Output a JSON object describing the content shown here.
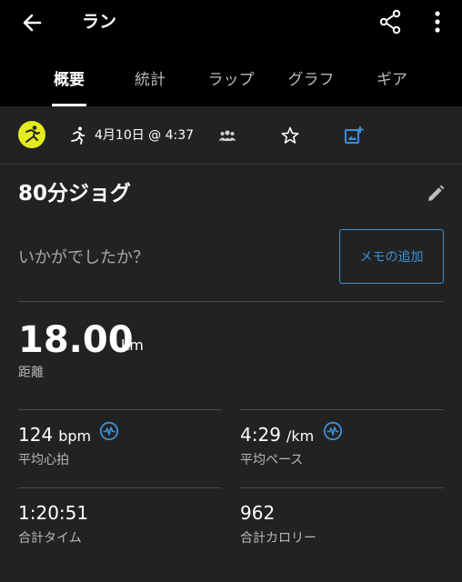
{
  "header": {
    "title": "ラン",
    "icons": [
      "back-arrow-icon",
      "share-icon",
      "more-vertical-icon"
    ]
  },
  "tabs": [
    {
      "label": "概要",
      "active": true
    },
    {
      "label": "統計",
      "active": false
    },
    {
      "label": "ラップ",
      "active": false
    },
    {
      "label": "グラフ",
      "active": false
    },
    {
      "label": "ギア",
      "active": false
    }
  ],
  "activity": {
    "date": "4月10日 @ 4:37",
    "badge_color": "#e2ec1f",
    "name": "80分ジョグ",
    "prompt": "いかがでしたか？",
    "memo_button": "メモの追加"
  },
  "stats": {
    "distance": {
      "value": "18.00",
      "unit": "km",
      "label": "距離"
    },
    "avg_hr": {
      "value": "124",
      "unit": "bpm",
      "label": "平均心拍"
    },
    "avg_pace": {
      "value": "4:29",
      "unit": "/km",
      "label": "平均ペース"
    },
    "total_time": {
      "value": "1:20:51",
      "label": "合計タイム"
    },
    "total_calories": {
      "value": "962",
      "label": "合計カロリー"
    }
  },
  "colors": {
    "accent": "#3d8fd6",
    "background": "#222222",
    "header": "#000000"
  }
}
